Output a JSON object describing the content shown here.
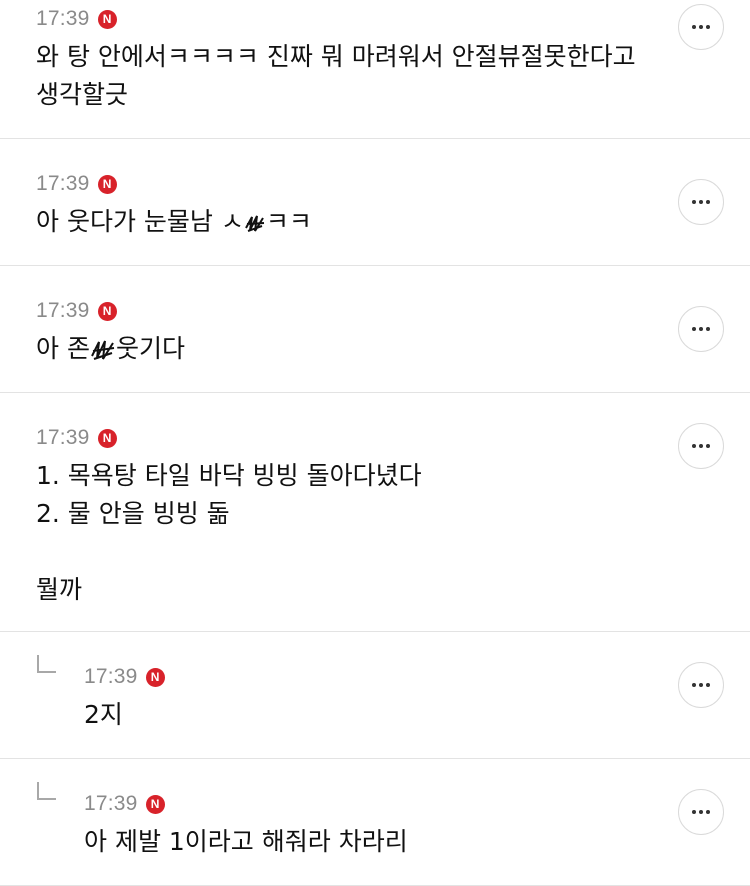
{
  "comments": [
    {
      "time": "17:39",
      "badge": "N",
      "text": "와 탕 안에서ㅋㅋㅋㅋ 진짜 뭐 마려워서 안절뷰절못한다고\n생각할긋",
      "reply": false
    },
    {
      "time": "17:39",
      "badge": "N",
      "text_before": "아 웃다가 눈물남 ㅅ",
      "text_after": "ㅋㅋ",
      "reply": false
    },
    {
      "time": "17:39",
      "badge": "N",
      "text_before": "아 존",
      "text_after": "웃기다",
      "reply": false
    },
    {
      "time": "17:39",
      "badge": "N",
      "text": "1. 목욕탕 타일 바닥 빙빙 돌아다녔다\n2. 물 안을 빙빙 돎\n\n뭘까",
      "reply": false
    },
    {
      "time": "17:39",
      "badge": "N",
      "text": "2지",
      "reply": true
    },
    {
      "time": "17:39",
      "badge": "N",
      "text": "아 제발 1이라고 해줘라 차라리",
      "reply": true
    }
  ],
  "icons": {
    "more": "more-horizontal-icon",
    "reply": "reply-arrow-icon",
    "badge": "n-badge-icon"
  },
  "colors": {
    "badge": "#d8222a",
    "time": "#8a8a8a",
    "divider": "#e3e3e3"
  }
}
